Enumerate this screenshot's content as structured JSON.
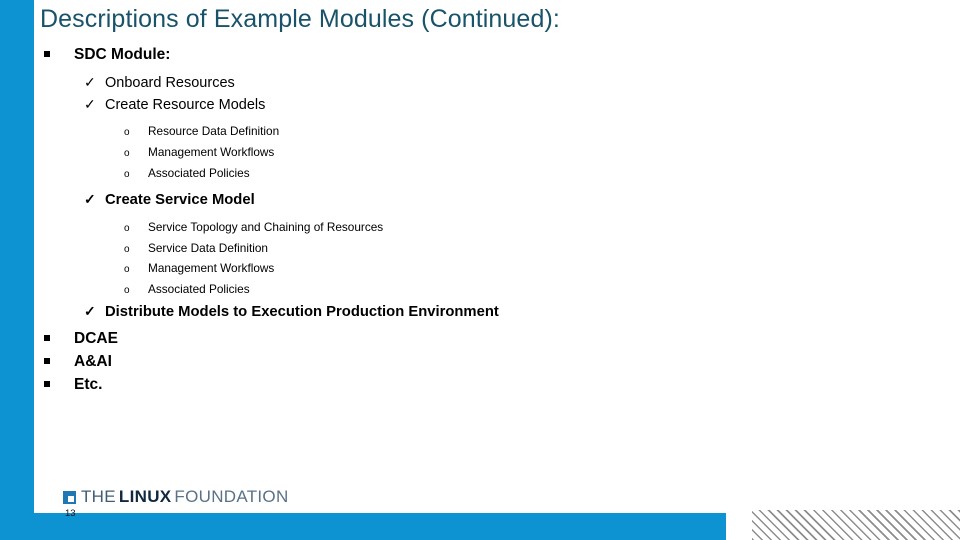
{
  "slide": {
    "title": "Descriptions of Example Modules (Continued):",
    "page_number": "13"
  },
  "colors": {
    "accent_blue": "#0d93d2",
    "title_teal": "#18536a",
    "body_black": "#000000",
    "hatch_gray": "#8d8d8d"
  },
  "bullets": {
    "square": "▪",
    "check": "✓",
    "circle": "o"
  },
  "content": [
    {
      "level": 1,
      "bullet": "square",
      "text": "SDC Module:"
    },
    {
      "level": 2,
      "bullet": "check",
      "text": "Onboard Resources"
    },
    {
      "level": 2,
      "bullet": "check",
      "text": "Create Resource Models"
    },
    {
      "level": 3,
      "bullet": "circle",
      "text": "Resource Data Definition"
    },
    {
      "level": 3,
      "bullet": "circle",
      "text": "Management Workflows"
    },
    {
      "level": 3,
      "bullet": "circle",
      "text": "Associated Policies"
    },
    {
      "level": 2,
      "bullet": "check",
      "text": "Create Service Model"
    },
    {
      "level": 3,
      "bullet": "circle",
      "text": "Service Topology and Chaining of Resources"
    },
    {
      "level": 3,
      "bullet": "circle",
      "text": "Service Data Definition"
    },
    {
      "level": 3,
      "bullet": "circle",
      "text": "Management Workflows"
    },
    {
      "level": 3,
      "bullet": "circle",
      "text": "Associated Policies"
    },
    {
      "level": 2,
      "bullet": "check",
      "text": "Distribute Models to Execution Production Environment"
    },
    {
      "level": 1,
      "bullet": "square",
      "text": "DCAE"
    },
    {
      "level": 1,
      "bullet": "square",
      "text": "A&AI"
    },
    {
      "level": 1,
      "bullet": "square",
      "text": "Etc."
    }
  ],
  "footer": {
    "logo": {
      "mark": "linux-foundation-mark",
      "word_the": "THE",
      "word_linux": "LINUX",
      "word_foundation": "FOUNDATION"
    }
  }
}
